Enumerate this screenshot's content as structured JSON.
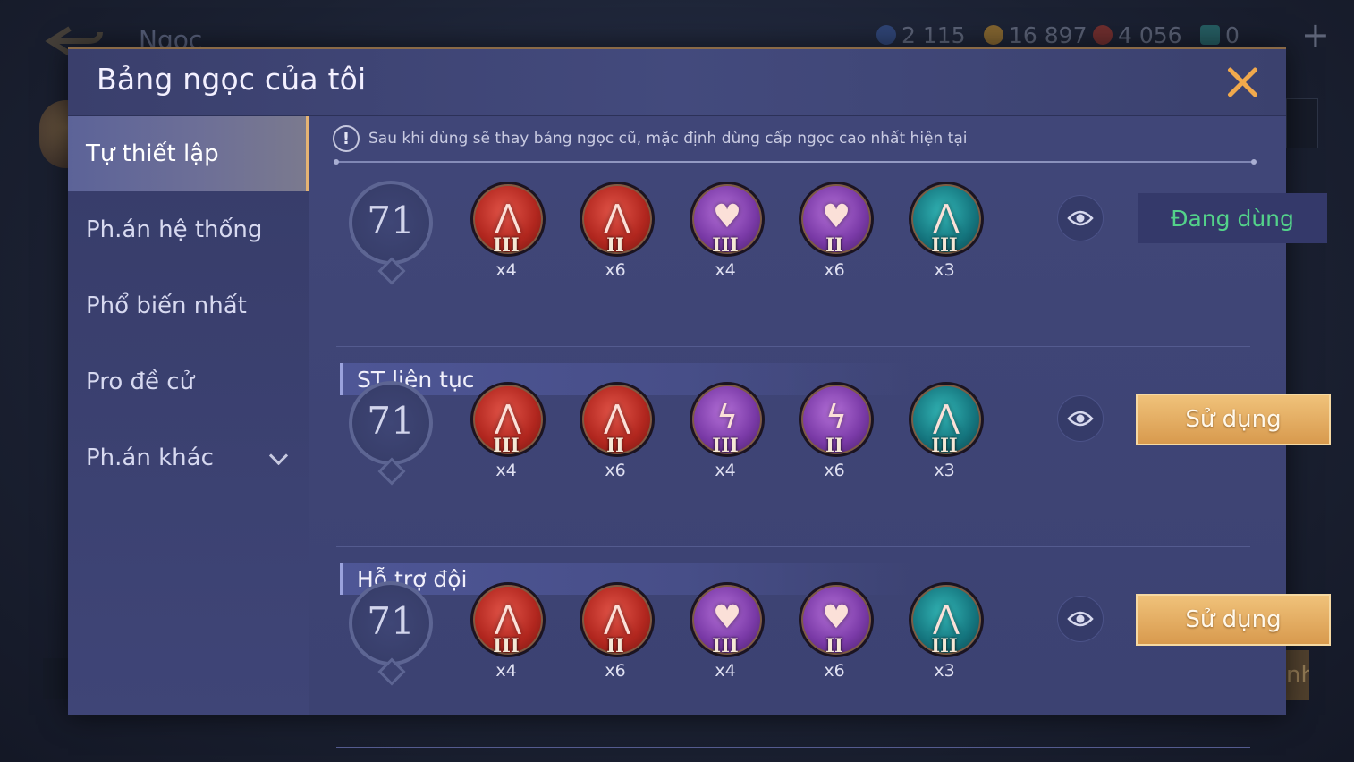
{
  "background": {
    "title": "Ngọc",
    "currencies": [
      {
        "icon": "blue-gem-icon",
        "value": "2 115",
        "color": "#3d5fa8"
      },
      {
        "icon": "gold-coin-icon",
        "value": "16 897",
        "color": "#d69a2c"
      },
      {
        "icon": "red-gem-icon",
        "value": "4 056",
        "color": "#b53a2c"
      },
      {
        "icon": "teal-card-icon",
        "value": "0",
        "color": "#2f8f8a"
      }
    ],
    "bottom_button_partial": "nh"
  },
  "modal": {
    "title": "Bảng ngọc của tôi",
    "notice": "Sau khi dùng sẽ thay bảng ngọc cũ, mặc định dùng cấp ngọc cao nhất hiện tại"
  },
  "sidebar": {
    "items": [
      {
        "label": "Tự thiết lập",
        "active": true
      },
      {
        "label": "Ph.án hệ thống"
      },
      {
        "label": "Phổ biến nhất"
      },
      {
        "label": "Pro đề cử"
      },
      {
        "label": "Ph.án khác",
        "expandable": true
      }
    ]
  },
  "pages": [
    {
      "name": "",
      "level": "71",
      "button": "Đang dùng",
      "button_state": "active",
      "gems": [
        {
          "color": "red",
          "icon": "red-gem-icon",
          "tier": "III",
          "count": "x4"
        },
        {
          "color": "red",
          "icon": "red-gem-icon",
          "tier": "II",
          "count": "x6"
        },
        {
          "color": "purple",
          "icon": "heart-gem-icon",
          "tier": "III",
          "count": "x4"
        },
        {
          "color": "purple",
          "icon": "heart-gem-icon",
          "tier": "II",
          "count": "x6"
        },
        {
          "color": "teal",
          "icon": "teal-gem-icon",
          "tier": "III",
          "count": "x3"
        }
      ]
    },
    {
      "name": "ST liên tục",
      "level": "71",
      "button": "Sử dụng",
      "gems": [
        {
          "color": "red",
          "icon": "red-gem-icon",
          "tier": "III",
          "count": "x4"
        },
        {
          "color": "red",
          "icon": "red-gem-icon",
          "tier": "II",
          "count": "x6"
        },
        {
          "color": "purple",
          "icon": "lightning-gem-icon",
          "tier": "III",
          "count": "x4"
        },
        {
          "color": "purple",
          "icon": "lightning-gem-icon",
          "tier": "II",
          "count": "x6"
        },
        {
          "color": "teal",
          "icon": "teal-gem-icon",
          "tier": "III",
          "count": "x3"
        }
      ]
    },
    {
      "name": "Hỗ trợ đội",
      "level": "71",
      "button": "Sử dụng",
      "gems": [
        {
          "color": "red",
          "icon": "red-gem-icon",
          "tier": "III",
          "count": "x4"
        },
        {
          "color": "red",
          "icon": "red-gem-icon",
          "tier": "II",
          "count": "x6"
        },
        {
          "color": "purple",
          "icon": "heart-gem-icon",
          "tier": "III",
          "count": "x4"
        },
        {
          "color": "purple",
          "icon": "heart-gem-icon",
          "tier": "II",
          "count": "x6"
        },
        {
          "color": "teal",
          "icon": "teal-gem-icon",
          "tier": "III",
          "count": "x3"
        }
      ]
    }
  ],
  "colors": {
    "accent_gold": "#e4b373",
    "active_green": "#53d28a",
    "close_orange": "#f1a94c"
  }
}
